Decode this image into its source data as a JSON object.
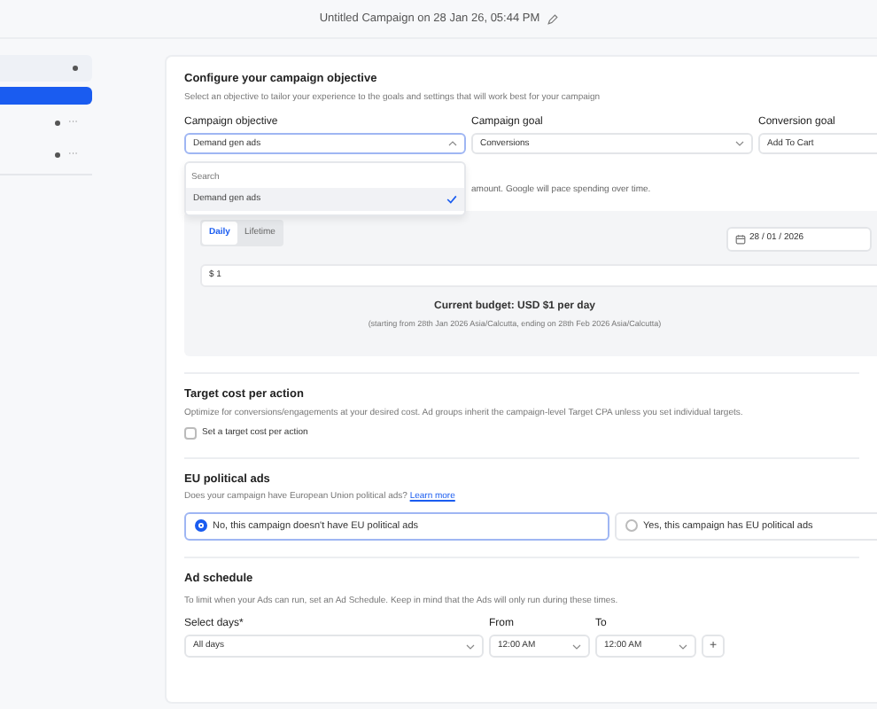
{
  "header": {
    "title": "Untitled Campaign on 28 Jan 26, 05:44 PM"
  },
  "sidebar": {
    "items": [
      {
        "kind": "group",
        "selected": false
      },
      {
        "kind": "step",
        "selected": true
      },
      {
        "kind": "step",
        "selected": false,
        "more": "···"
      },
      {
        "kind": "step",
        "selected": false,
        "more": "···"
      }
    ]
  },
  "objective": {
    "title": "Configure your campaign objective",
    "description": "Select an objective to tailor your experience to the goals and settings that will work best for your campaign",
    "fields": [
      {
        "label": "Campaign objective",
        "value": "Demand gen ads",
        "expanded": true
      },
      {
        "label": "Campaign goal",
        "value": "Conversions",
        "expanded": false
      },
      {
        "label": "Conversion goal",
        "value": "Add To Cart"
      }
    ],
    "dropdown": {
      "placeholder": "Search",
      "options": [
        {
          "label": "Demand gen ads",
          "selected": true
        }
      ]
    }
  },
  "budget": {
    "description": "amount. Google will pace spending over time.",
    "tabs": [
      {
        "label": "Daily",
        "selected": true
      },
      {
        "label": "Lifetime",
        "selected": false
      }
    ],
    "start_date": "28 / 01 / 2026",
    "amount": "$ 1",
    "current": "Current budget:  USD $1 per day",
    "period": "(starting from 28th Jan 2026 Asia/Calcutta, ending on 28th Feb 2026 Asia/Calcutta)"
  },
  "target_cpa": {
    "title": "Target cost per action",
    "description": "Optimize for conversions/engagements at your desired cost. Ad groups inherit the campaign-level Target CPA unless you set individual targets.",
    "checkbox": {
      "label": "Set a target cost per action",
      "checked": false
    }
  },
  "eu_political": {
    "title": "EU political ads",
    "description": "Does your campaign have European Union political ads?",
    "link": "Learn more",
    "options": [
      {
        "label": "No, this campaign doesn't have EU political ads",
        "selected": true
      },
      {
        "label": "Yes, this campaign has EU political ads",
        "selected": false
      }
    ]
  },
  "schedule": {
    "title": "Ad schedule",
    "description": "To limit when your Ads can run, set an Ad Schedule. Keep in mind that the Ads will only run during these times.",
    "fields": [
      {
        "label": "Select days*",
        "value": "All days"
      },
      {
        "label": "From",
        "value": "12:00 AM"
      },
      {
        "label": "To",
        "value": "12:00 AM"
      }
    ],
    "add_button": "+"
  }
}
